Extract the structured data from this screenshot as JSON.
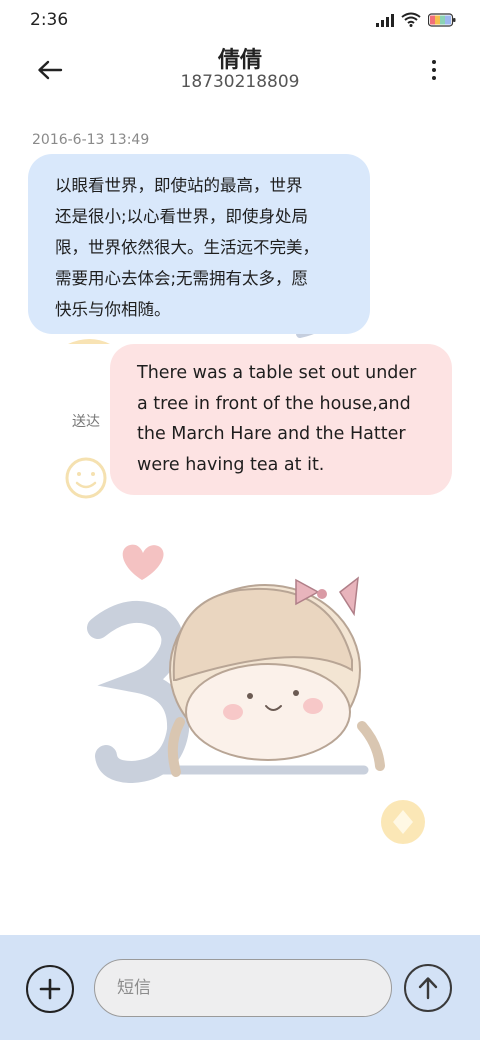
{
  "status_bar": {
    "time": "2:36",
    "icons": [
      "signal-icon",
      "wifi-icon",
      "battery-icon"
    ]
  },
  "header": {
    "contact_name": "倩倩",
    "phone_number": "18730218809",
    "back_icon": "back-arrow-icon",
    "more_icon": "more-vertical-icon"
  },
  "conversation": {
    "timestamp": "2016-6-13 13:49",
    "incoming_message": {
      "lines": [
        "以眼看世界，即使站的最高，世界",
        "还是很小;以心看世界，即使身处局",
        "限，世界依然很大。生活远不完美，",
        "需要用心去体会;无需拥有太多，愿",
        "快乐与你相随。"
      ]
    },
    "outgoing_message": {
      "lines": [
        "There was a table set out under",
        "a tree in front of the house,and",
        "the March Hare and the Hatter",
        "were having tea at it."
      ],
      "status": "送达"
    }
  },
  "composer": {
    "placeholder": "短信",
    "add_icon": "plus-icon",
    "send_icon": "send-arrow-icon"
  },
  "colors": {
    "incoming_bubble": "#d9e8fb",
    "outgoing_bubble": "#fde3e3",
    "bottom_bar": "#d3e2f6"
  }
}
